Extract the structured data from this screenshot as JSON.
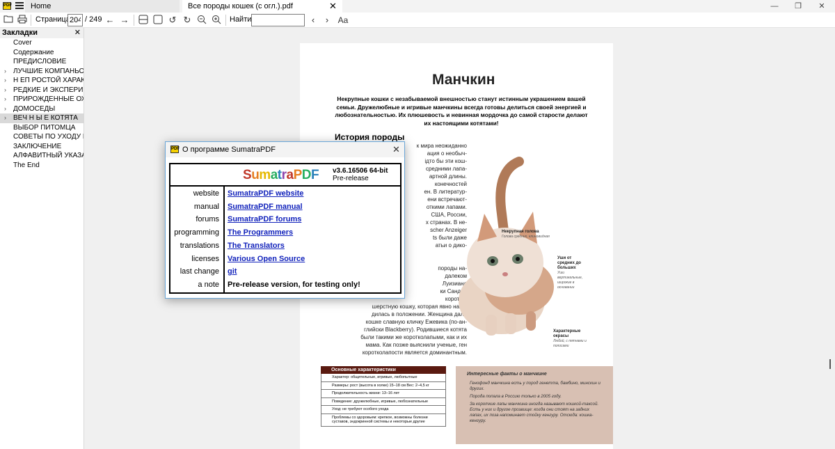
{
  "titlebar": {
    "tabs": [
      {
        "label": "Home"
      },
      {
        "label": "Все породы кошек (с огл.).pdf"
      }
    ],
    "logo_text": "PDF"
  },
  "toolbar": {
    "page_label": "Страница:",
    "page_current": "204",
    "page_total": "/ 249",
    "find_label": "Найти:",
    "find_value": "",
    "case_toggle": "Aa"
  },
  "sidebar": {
    "title": "Закладки",
    "items": [
      {
        "label": "Cover",
        "expandable": false
      },
      {
        "label": "Содержание",
        "expandable": false
      },
      {
        "label": "ПРЕДИСЛОВИЕ",
        "expandable": false
      },
      {
        "label": "ЛУЧШИЕ КОМПАНЬОНЫ",
        "expandable": true
      },
      {
        "label": "Н ЕП РОСТОЙ ХАРАКТЕР",
        "expandable": true
      },
      {
        "label": "РЕДКИЕ И ЭКСПЕРИМЕН",
        "expandable": true
      },
      {
        "label": "ПРИРОЖДЕННЫЕ ОХОТН",
        "expandable": true
      },
      {
        "label": "ДОМОСЕДЫ",
        "expandable": true
      },
      {
        "label": "ВЕЧ Н Ы Е КОТЯТА",
        "expandable": true,
        "selected": true
      },
      {
        "label": "ВЫБОР ПИТОМЦА",
        "expandable": false
      },
      {
        "label": "СОВЕТЫ ПО УХОДУ И СО",
        "expandable": false
      },
      {
        "label": "ЗАКЛЮЧЕНИЕ",
        "expandable": false
      },
      {
        "label": "АЛФАВИТНЫЙ УКАЗАТЕ.",
        "expandable": false
      },
      {
        "label": "The End",
        "expandable": false
      }
    ]
  },
  "document": {
    "title": "Манчкин",
    "lead": "Некрупные кошки с незабываемой внешностью станут истинным украшением вашей семьи. Дружелюбные и игривые манчкины всегда готовы делиться своей энергией и любознательностью. Их плюшевость и невинная мордочка до самой старости делают их настоящими котятами!",
    "history_title": "История породы",
    "body_lines": [
      "к мира неожиданно",
      "ация о необыч-",
      "ідто бы эти кош-",
      "средними лапа-",
      "артной длины.",
      "конечностей",
      "ен. В литератур-",
      "ени встречают-",
      "откими лапами.",
      "США, России,",
      "х странах. В не-",
      "scher Anzeiger",
      "ts были даже",
      "атьи о дико-",
      "",
      "",
      "породы на-",
      "далеком",
      "Луизиана",
      "ки Сандра",
      "коротко-",
      "шерстную кошку, которая явно нахо-",
      "дилась в положении. Женщина дала",
      "кошке славную кличку Ежевика (по-ан-",
      "глийски Blackberry). Родившиеся котята",
      "были такими же коротколапыми, как и их",
      "мама. Как позже выяснили ученые, ген",
      "коротколапости является доминантным."
    ],
    "callouts": {
      "head": "Некрупная голова",
      "head_sub": "Голова средних, клиновидная",
      "ears": "Уши от средних до больших",
      "ears_sub": "Уши вертикальные, широкие в основании",
      "colors": "Характерные окрасы",
      "colors_sub": "Любой, с пятнами и полосами"
    },
    "characteristics": {
      "title": "Основные характеристики",
      "rows": [
        "Характер: общительные, игривые, любопытные",
        "Размеры: рост (высота в холке) 15–18 см Вес: 2–4,5 кг",
        "Продолжительность жизни: 13–16 лет",
        "Поведение: дружелюбные, игривые, любознательные",
        "Уход: не требуют особого ухода",
        "Проблемы со здоровьем: крепкое, возможны болезни суставов, эндокринной системы и некоторые другие"
      ]
    },
    "facts": {
      "title": "Интересные факты о манчкине",
      "items": [
        "Генофонд манчкина есть у пород генетта, бамбино, минскин и других.",
        "Порода попала в Россию только в 2005 году.",
        "За короткие лапы манчкина иногда называют кошкой-таксой. Есть у них и другое прозвище: когда они стоят на задних лапах, их поза напоминает стойку кенгуру. Отсюда: кошка-кенгуру."
      ]
    }
  },
  "dialog": {
    "title": "О программе SumatraPDF",
    "logo_text": "SumatraPDF",
    "logo_colors": [
      "#c0392b",
      "#e67e22",
      "#e6b800",
      "#27ae60",
      "#2980b9",
      "#8e44ad",
      "#c0392b",
      "#e67e22",
      "#27ae60",
      "#2980b9"
    ],
    "version": "v3.6.16506 64-bit",
    "release": "Pre-release",
    "rows": [
      {
        "key": "website",
        "value": "SumatraPDF website",
        "link": true
      },
      {
        "key": "manual",
        "value": "SumatraPDF manual",
        "link": true
      },
      {
        "key": "forums",
        "value": "SumatraPDF forums",
        "link": true
      },
      {
        "key": "programming",
        "value": "The Programmers",
        "link": true
      },
      {
        "key": "translations",
        "value": "The Translators",
        "link": true
      },
      {
        "key": "licenses",
        "value": "Various Open Source",
        "link": true
      },
      {
        "key": "last change",
        "value": "git",
        "link": true
      },
      {
        "key": "a note",
        "value": "Pre-release version, for testing only!",
        "link": false
      }
    ]
  }
}
